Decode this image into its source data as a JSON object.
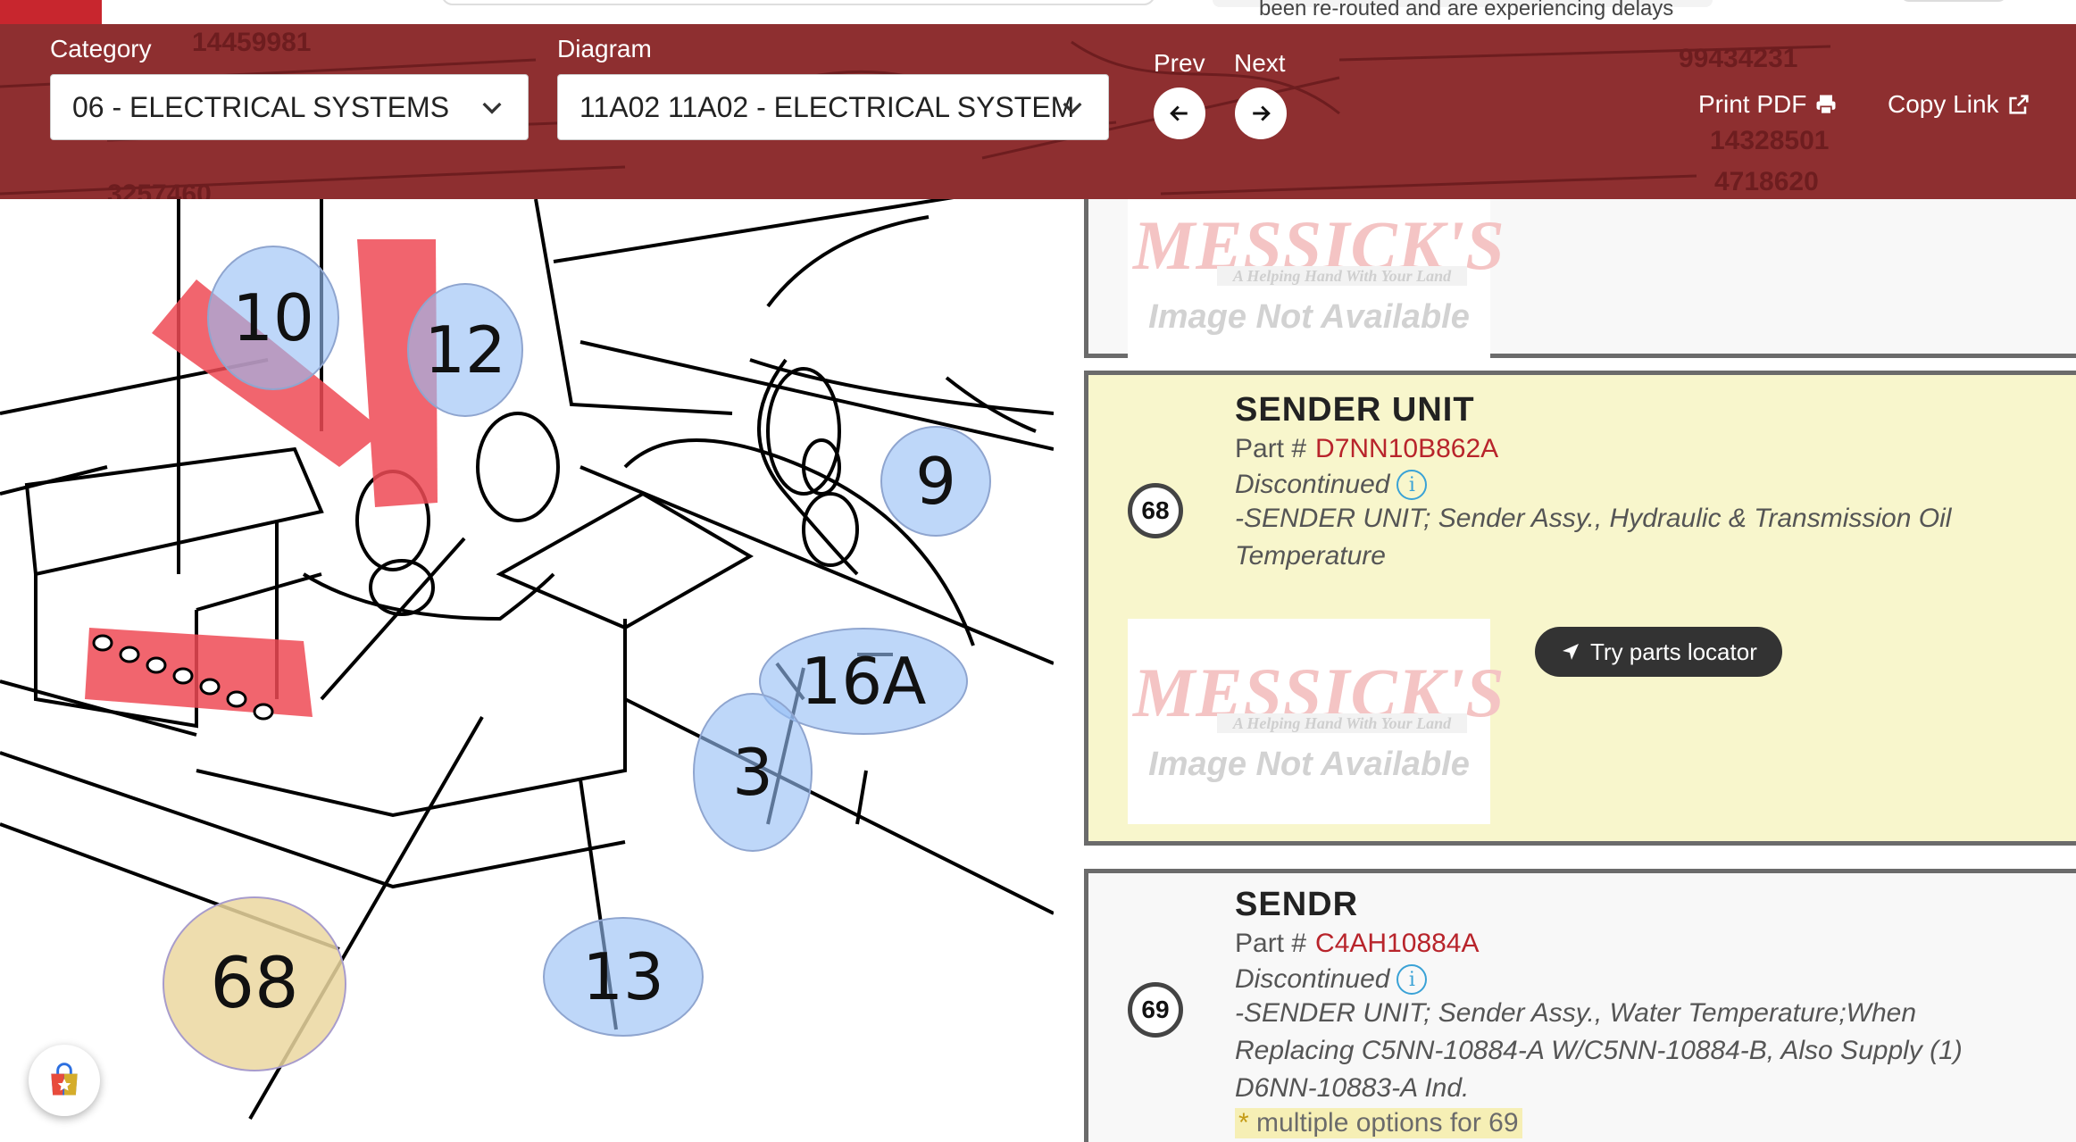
{
  "top": {
    "notice_text": "been re-routed and are experiencing delays"
  },
  "header": {
    "category_label": "Category",
    "category_value": "06 - ELECTRICAL SYSTEMS",
    "diagram_label": "Diagram",
    "diagram_value": "11A02 11A02 - ELECTRICAL SYSTEM",
    "prev_label": "Prev",
    "next_label": "Next",
    "print_label": "Print PDF",
    "copy_label": "Copy Link",
    "bg_numbers": [
      "14459981",
      "99434231",
      "14328501",
      "4718620",
      "3257460"
    ]
  },
  "diagram": {
    "callouts": [
      "10",
      "12",
      "9",
      "16A",
      "3",
      "68",
      "13"
    ],
    "selected": "68"
  },
  "parts": [
    {
      "number": "",
      "title": "",
      "image_brand": "MESSICK'S",
      "image_tagline": "A Helping Hand With Your Land",
      "image_text": "Image Not Available"
    },
    {
      "number": "68",
      "title": "SENDER UNIT",
      "part_label": "Part #",
      "part_number": "D7NN10B862A",
      "status": "Discontinued",
      "description": "-SENDER UNIT; Sender Assy., Hydraulic & Transmission Oil Temperature",
      "locator_label": "Try parts locator",
      "image_brand": "MESSICK'S",
      "image_tagline": "A Helping Hand With Your Land",
      "image_text": "Image Not Available"
    },
    {
      "number": "69",
      "title": "SENDR",
      "part_label": "Part #",
      "part_number": "C4AH10884A",
      "status": "Discontinued",
      "description": "-SENDER UNIT; Sender Assy., Water Temperature;When Replacing C5NN-10884-A W/C5NN-10884-B, Also Supply (1) D6NN-10883-A Ind.",
      "multi_star": "*",
      "multi_text": "multiple options for 69"
    }
  ],
  "colors": {
    "header_bg": "#8e2f30",
    "highlight_card": "#f8f6cc",
    "part_number": "#b8242b",
    "callout_blue": "#96bef5",
    "callout_selected": "#ebd7a0"
  },
  "icons": [
    "chevron-down-icon",
    "arrow-left-icon",
    "arrow-right-icon",
    "printer-icon",
    "external-link-icon",
    "info-icon",
    "location-arrow-icon",
    "shopping-bag-star-icon"
  ]
}
